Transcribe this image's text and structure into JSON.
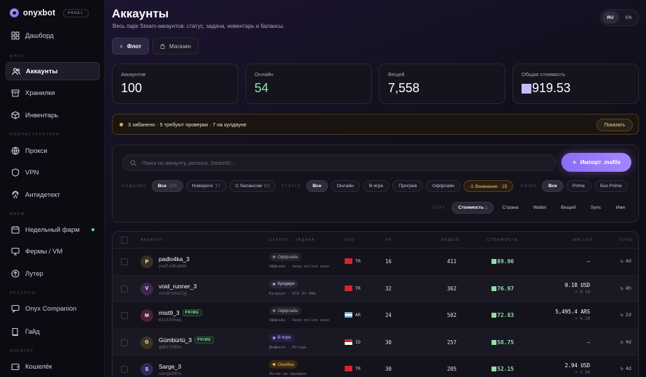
{
  "brand": {
    "name": "onyxbot",
    "badge": "PANEL"
  },
  "sidebar": {
    "items": [
      {
        "label": "Дашборд",
        "icon": "grid-icon"
      },
      {
        "section": "ФЛОТ"
      },
      {
        "label": "Аккаунты",
        "icon": "users-icon",
        "active": true
      },
      {
        "label": "Хранилки",
        "icon": "archive-icon"
      },
      {
        "label": "Инвентарь",
        "icon": "cube-icon"
      },
      {
        "section": "ИНФРАСТРУКТУРА"
      },
      {
        "label": "Прокси",
        "icon": "globe-icon"
      },
      {
        "label": "VPN",
        "icon": "shield-icon"
      },
      {
        "label": "Антидетект",
        "icon": "fingerprint-icon"
      },
      {
        "section": "ФАРМ"
      },
      {
        "label": "Недельный фарм",
        "icon": "calendar-icon"
      },
      {
        "label": "Фермы / VM",
        "icon": "monitor-icon"
      },
      {
        "label": "Лутер",
        "icon": "loot-icon"
      },
      {
        "section": "РЕСУРСЫ"
      },
      {
        "label": "Onyx Companion",
        "icon": "chat-icon"
      },
      {
        "label": "Гайд",
        "icon": "book-icon"
      },
      {
        "section": "АККАУНТ"
      },
      {
        "label": "Кошелёк",
        "icon": "wallet-icon"
      }
    ]
  },
  "header": {
    "title": "Аккаунты",
    "subtitle": "Весь парк Steam-аккаунтов: статус, задача, инвентарь и балансы.",
    "lang": [
      "RU",
      "EN"
    ],
    "tabs": [
      "Флот",
      "Магазин"
    ]
  },
  "stats": [
    {
      "label": "Аккаунтов",
      "value": "100"
    },
    {
      "label": "Онлайн",
      "value": "54"
    },
    {
      "label": "Вещей",
      "value": "7,558"
    },
    {
      "label": "Общая стоимость",
      "value": "919.53"
    }
  ],
  "alert": {
    "text": "3 забанено · 5 требуют проверки · 7 на кулдауне",
    "button": "Показать"
  },
  "filters": {
    "search_placeholder": "Поиск по аккаунту, persona, SteamID...",
    "import_label": "Импорт .mafile",
    "wallet_label": "КОШЕЛЁК",
    "wallet_chips": [
      {
        "label": "Все",
        "count": "100"
      },
      {
        "label": "Новореги",
        "count": "17"
      },
      {
        "label": "С балансом",
        "count": "83"
      }
    ],
    "status_label": "СТАТУС",
    "status_chips": [
      "Все",
      "Онлайн",
      "В игре",
      "Прогрев",
      "Оффлайн",
      "⚠ Внимание · 15"
    ],
    "prime_label": "PRIME",
    "prime_chips": [
      "Все",
      "Prime",
      "Без Prime"
    ],
    "sort_label": "СОРТ.",
    "sort_chips": [
      "Стоимость ↓",
      "Страна",
      "Wallet",
      "Вещей",
      "Sync",
      "Имя"
    ]
  },
  "table": {
    "headers": [
      "АККАУНТ",
      "СТАТУС · ЗАДАЧА",
      "ГЕО",
      "УР.",
      "ВЕЩЕЙ",
      "СТОИМОСТЬ",
      "WALLET",
      "SYNC"
    ],
    "rows": [
      {
        "initial": "P",
        "name": "padlo4ka_3",
        "login": "padlo4ka94k",
        "prime": "",
        "status": "Оффлайн",
        "task": "Оффлайн · keep-online окно",
        "geo": "TR",
        "level": "16",
        "items": "411",
        "cost": "89.96",
        "wallet": "—",
        "wallet_sub": "",
        "sync": "4d"
      },
      {
        "initial": "V",
        "name": "void_runner_3",
        "login": "voidrunn1lg",
        "prime": "",
        "status": "Кулдаун",
        "task": "Кулдаун · ETA 3ч 48м",
        "geo": "TR",
        "level": "32",
        "items": "362",
        "cost": "76.97",
        "wallet": "0.18 USD",
        "wallet_sub": "≈ 0.18",
        "sync": "4h"
      },
      {
        "initial": "M",
        "name": "mist9_3",
        "login": "mist93heq",
        "prime": "PRIME",
        "status": "Оффлайн",
        "task": "Оффлайн · keep-online окно",
        "geo": "AR",
        "level": "24",
        "items": "502",
        "cost": "72.83",
        "wallet": "5,495.4 ARS",
        "wallet_sub": "≈ 4.28",
        "sync": "2d"
      },
      {
        "initial": "G",
        "name": "Gümbürtü_3",
        "login": "gmbrt389x",
        "prime": "PRIME",
        "status": "В игре",
        "task": "Дофмати · Mirage",
        "geo": "ID",
        "level": "30",
        "items": "257",
        "cost": "58.75",
        "wallet": "—",
        "wallet_sub": "",
        "sync": "4d"
      },
      {
        "initial": "S",
        "name": "Sarge_3",
        "login": "sarge395s",
        "prime": "",
        "status": "Ошибка",
        "task": "Логин не пройден",
        "geo": "TR",
        "level": "30",
        "items": "205",
        "cost": "52.15",
        "wallet": "2.94 USD",
        "wallet_sub": "≈ 2.94",
        "sync": "4d"
      }
    ]
  }
}
